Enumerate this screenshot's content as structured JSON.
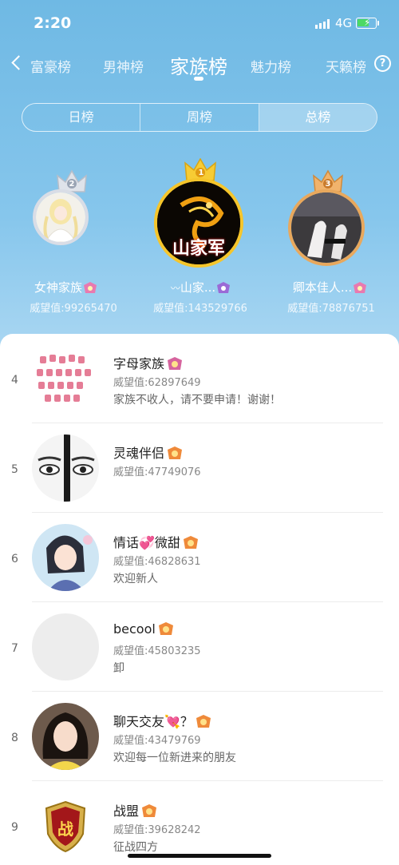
{
  "status_bar": {
    "time": "2:20",
    "network": "4G"
  },
  "nav": {
    "tabs": [
      {
        "label": "富豪榜"
      },
      {
        "label": "男神榜"
      },
      {
        "label": "家族榜"
      },
      {
        "label": "魅力榜"
      },
      {
        "label": "天籁榜"
      }
    ],
    "help": "?"
  },
  "period": {
    "items": [
      "日榜",
      "周榜",
      "总榜"
    ],
    "selected": "总榜"
  },
  "podium": [
    {
      "rank": "2",
      "name": "女神家族",
      "score": "威望值:99265470"
    },
    {
      "rank": "1",
      "name": "山家...",
      "score": "威望值:143529766",
      "logo_text": "山家军"
    },
    {
      "rank": "3",
      "name": "卿本佳人...",
      "score": "威望值:78876751"
    }
  ],
  "list": [
    {
      "rank": "4",
      "name": "字母家族",
      "score": "威望值:62897649",
      "motto": "家族不收人，请不要申请！谢谢！"
    },
    {
      "rank": "5",
      "name": "灵魂伴侣",
      "score": "威望值:47749076",
      "motto": ""
    },
    {
      "rank": "6",
      "name": "情话💞微甜",
      "score": "威望值:46828631",
      "motto": "欢迎新人"
    },
    {
      "rank": "7",
      "name": "becool",
      "score": "威望值:45803235",
      "motto": "卸"
    },
    {
      "rank": "8",
      "name": "聊天交友💘？",
      "score": "威望值:43479769",
      "motto": "欢迎每一位新进来的朋友"
    },
    {
      "rank": "9",
      "name": "战盟",
      "score": "威望值:39628242",
      "motto": "征战四方",
      "logo_text": "战"
    }
  ],
  "colors": {
    "gold": "#f5c52b",
    "silver": "#d9dde6",
    "bronze": "#e8a85d",
    "accent": "#6fb9e4"
  }
}
